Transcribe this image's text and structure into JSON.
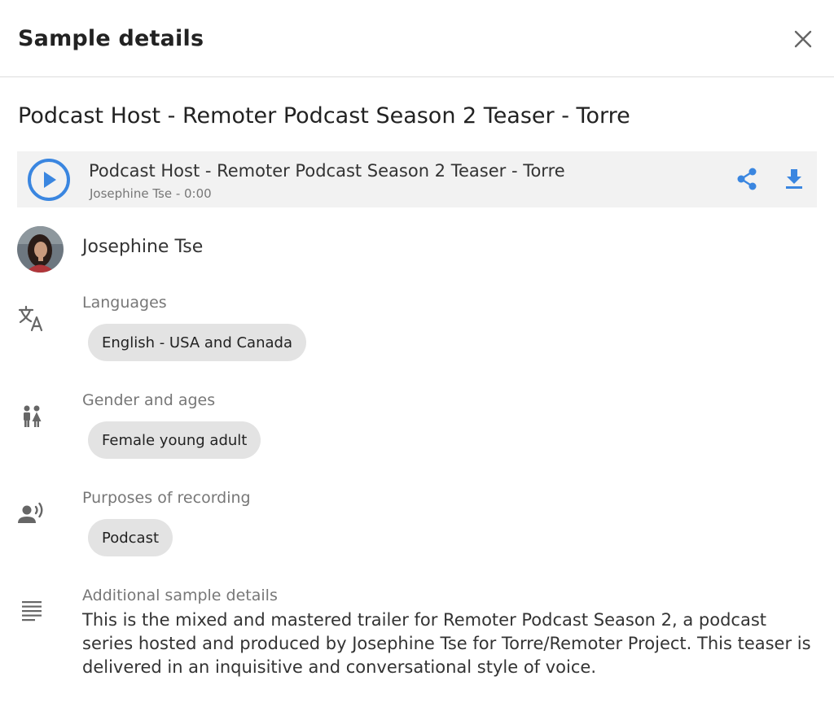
{
  "header": {
    "title": "Sample details"
  },
  "sample": {
    "title": "Podcast Host - Remoter Podcast Season 2 Teaser - Torre"
  },
  "player": {
    "track_title": "Podcast Host - Remoter Podcast Season 2 Teaser - Torre",
    "meta": "Josephine Tse - 0:00",
    "accent_color": "#3a86e0"
  },
  "person": {
    "name": "Josephine Tse"
  },
  "sections": {
    "languages": {
      "label": "Languages",
      "chips": [
        "English - USA and Canada"
      ]
    },
    "gender": {
      "label": "Gender and ages",
      "chips": [
        "Female young adult"
      ]
    },
    "purposes": {
      "label": "Purposes of recording",
      "chips": [
        "Podcast"
      ]
    },
    "details": {
      "label": "Additional sample details",
      "text": "This is the mixed and mastered trailer for Remoter Podcast Season 2, a podcast series hosted and produced by Josephine Tse for Torre/Remoter Project. This teaser is delivered in an inquisitive and conversational style of voice."
    }
  },
  "icons": {
    "close": "close-icon",
    "play": "play-icon",
    "share": "share-icon",
    "download": "download-icon",
    "languages": "translate-icon",
    "gender": "people-icon",
    "purposes": "record-voice-icon",
    "details": "notes-icon"
  }
}
